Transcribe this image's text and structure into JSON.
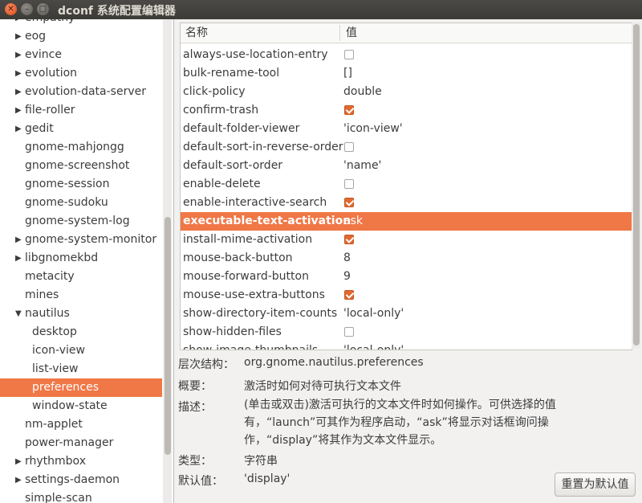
{
  "window": {
    "title": "dconf 系统配置编辑器"
  },
  "sidebar": {
    "items": [
      {
        "label": "empathy",
        "expander": "right"
      },
      {
        "label": "eog",
        "expander": "right"
      },
      {
        "label": "evince",
        "expander": "right"
      },
      {
        "label": "evolution",
        "expander": "right"
      },
      {
        "label": "evolution-data-server",
        "expander": "right"
      },
      {
        "label": "file-roller",
        "expander": "right"
      },
      {
        "label": "gedit",
        "expander": "right"
      },
      {
        "label": "gnome-mahjongg",
        "expander": "none"
      },
      {
        "label": "gnome-screenshot",
        "expander": "none"
      },
      {
        "label": "gnome-session",
        "expander": "none"
      },
      {
        "label": "gnome-sudoku",
        "expander": "none"
      },
      {
        "label": "gnome-system-log",
        "expander": "none"
      },
      {
        "label": "gnome-system-monitor",
        "expander": "right"
      },
      {
        "label": "libgnomekbd",
        "expander": "right"
      },
      {
        "label": "metacity",
        "expander": "none"
      },
      {
        "label": "mines",
        "expander": "none"
      },
      {
        "label": "nautilus",
        "expander": "down"
      },
      {
        "label": "desktop",
        "expander": "child"
      },
      {
        "label": "icon-view",
        "expander": "child"
      },
      {
        "label": "list-view",
        "expander": "child"
      },
      {
        "label": "preferences",
        "expander": "child",
        "selected": true
      },
      {
        "label": "window-state",
        "expander": "child"
      },
      {
        "label": "nm-applet",
        "expander": "none"
      },
      {
        "label": "power-manager",
        "expander": "none"
      },
      {
        "label": "rhythmbox",
        "expander": "right"
      },
      {
        "label": "settings-daemon",
        "expander": "right"
      },
      {
        "label": "simple-scan",
        "expander": "none"
      }
    ]
  },
  "table": {
    "col_name": "名称",
    "col_value": "值",
    "rows": [
      {
        "key": "always-use-location-entry",
        "type": "bool",
        "checked": false
      },
      {
        "key": "bulk-rename-tool",
        "type": "text",
        "value": "[]"
      },
      {
        "key": "click-policy",
        "type": "text",
        "value": "double"
      },
      {
        "key": "confirm-trash",
        "type": "bool",
        "checked": true
      },
      {
        "key": "default-folder-viewer",
        "type": "text",
        "value": "'icon-view'"
      },
      {
        "key": "default-sort-in-reverse-order",
        "type": "bool",
        "checked": false
      },
      {
        "key": "default-sort-order",
        "type": "text",
        "value": "'name'"
      },
      {
        "key": "enable-delete",
        "type": "bool",
        "checked": false
      },
      {
        "key": "enable-interactive-search",
        "type": "bool",
        "checked": true
      },
      {
        "key": "executable-text-activation",
        "type": "text",
        "value": "ask",
        "selected": true
      },
      {
        "key": "install-mime-activation",
        "type": "bool",
        "checked": true
      },
      {
        "key": "mouse-back-button",
        "type": "text",
        "value": "8"
      },
      {
        "key": "mouse-forward-button",
        "type": "text",
        "value": "9"
      },
      {
        "key": "mouse-use-extra-buttons",
        "type": "bool",
        "checked": true
      },
      {
        "key": "show-directory-item-counts",
        "type": "text",
        "value": "'local-only'"
      },
      {
        "key": "show-hidden-files",
        "type": "bool",
        "checked": false
      },
      {
        "key": "show-image-thumbnails",
        "type": "text",
        "value": "'local-only'"
      }
    ]
  },
  "details": {
    "schema_label": "层次结构：",
    "schema_value": "org.gnome.nautilus.preferences",
    "summary_label": "概要：",
    "summary_value": "激活时如何对待可执行文本文件",
    "description_label": "描述：",
    "description_value": "(单击或双击)激活可执行的文本文件时如何操作。可供选择的值有，“launch”可其作为程序启动，“ask”将显示对话框询问操作，“display”将其作为文本文件显示。",
    "type_label": "类型：",
    "type_value": "字符串",
    "default_label": "默认值：",
    "default_value": "'display'",
    "reset_button": "重置为默认值"
  },
  "colors": {
    "accent": "#f07746",
    "checkbox_on": "#e0692f",
    "titlebar": "#3c3b37"
  }
}
